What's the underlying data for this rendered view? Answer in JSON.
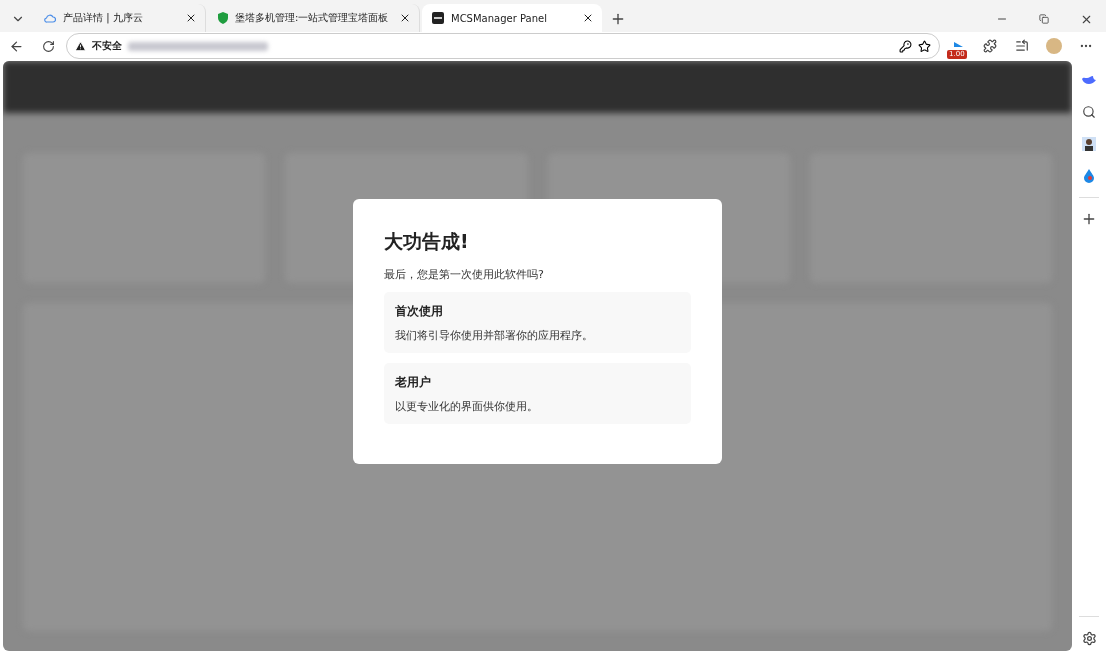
{
  "tabs": [
    {
      "title": "产品详情 | 九序云",
      "selected": false
    },
    {
      "title": "堡塔多机管理:一站式管理宝塔面板",
      "selected": false
    },
    {
      "title": "MCSManager Panel",
      "selected": true
    }
  ],
  "address_bar": {
    "security_label": "不安全"
  },
  "extension_badge": "1.00",
  "dialog": {
    "title": "大功告成!",
    "subtitle": "最后，您是第一次使用此软件吗?",
    "options": [
      {
        "title": "首次使用",
        "description": "我们将引导你使用并部署你的应用程序。"
      },
      {
        "title": "老用户",
        "description": "以更专业化的界面供你使用。"
      }
    ]
  }
}
